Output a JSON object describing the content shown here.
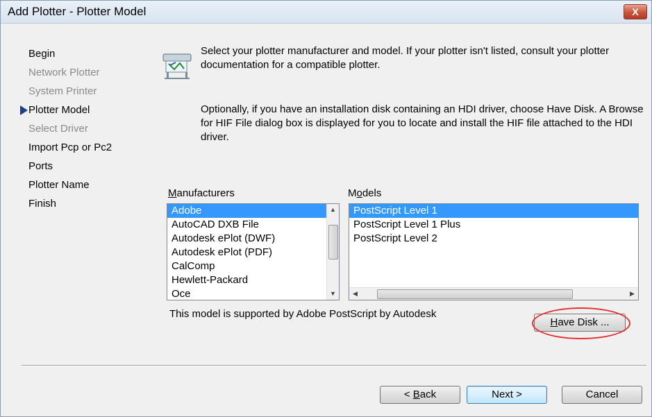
{
  "window": {
    "title": "Add Plotter - Plotter Model",
    "close_glyph": "X"
  },
  "steps": [
    {
      "label": "Begin",
      "state": "normal"
    },
    {
      "label": "Network Plotter",
      "state": "disabled"
    },
    {
      "label": "System Printer",
      "state": "disabled"
    },
    {
      "label": "Plotter Model",
      "state": "current"
    },
    {
      "label": "Select Driver",
      "state": "disabled"
    },
    {
      "label": "Import Pcp or Pc2",
      "state": "normal"
    },
    {
      "label": "Ports",
      "state": "normal"
    },
    {
      "label": "Plotter Name",
      "state": "normal"
    },
    {
      "label": "Finish",
      "state": "normal"
    }
  ],
  "description": {
    "para1": "Select your plotter manufacturer and model. If your plotter isn't listed, consult your plotter documentation for a compatible plotter.",
    "para2": "Optionally, if you have an installation disk containing an HDI driver, choose Have Disk. A Browse for HIF File dialog box is displayed for you to locate and install the HIF file attached to the HDI driver."
  },
  "manufacturers": {
    "label_hotkey": "M",
    "label_rest": "anufacturers",
    "items": [
      "Adobe",
      "AutoCAD DXB File",
      "Autodesk ePlot (DWF)",
      "Autodesk ePlot (PDF)",
      "CalComp",
      "Hewlett-Packard",
      "Oce"
    ],
    "selected": "Adobe"
  },
  "models": {
    "label_pre": "M",
    "label_hotkey": "o",
    "label_rest": "dels",
    "items": [
      "PostScript Level 1",
      "PostScript Level 1 Plus",
      "PostScript Level 2"
    ],
    "selected": "PostScript Level 1"
  },
  "support_text": "This model is supported by Adobe PostScript by Autodesk",
  "buttons": {
    "have_disk_hotkey": "H",
    "have_disk_rest": "ave Disk ...",
    "back_pre": "< ",
    "back_hotkey": "B",
    "back_rest": "ack",
    "next": "Next >",
    "cancel": "Cancel"
  },
  "colors": {
    "selection": "#3399ff",
    "highlight_oval": "#e53030",
    "current_step_arrow": "#1c3f8c"
  }
}
